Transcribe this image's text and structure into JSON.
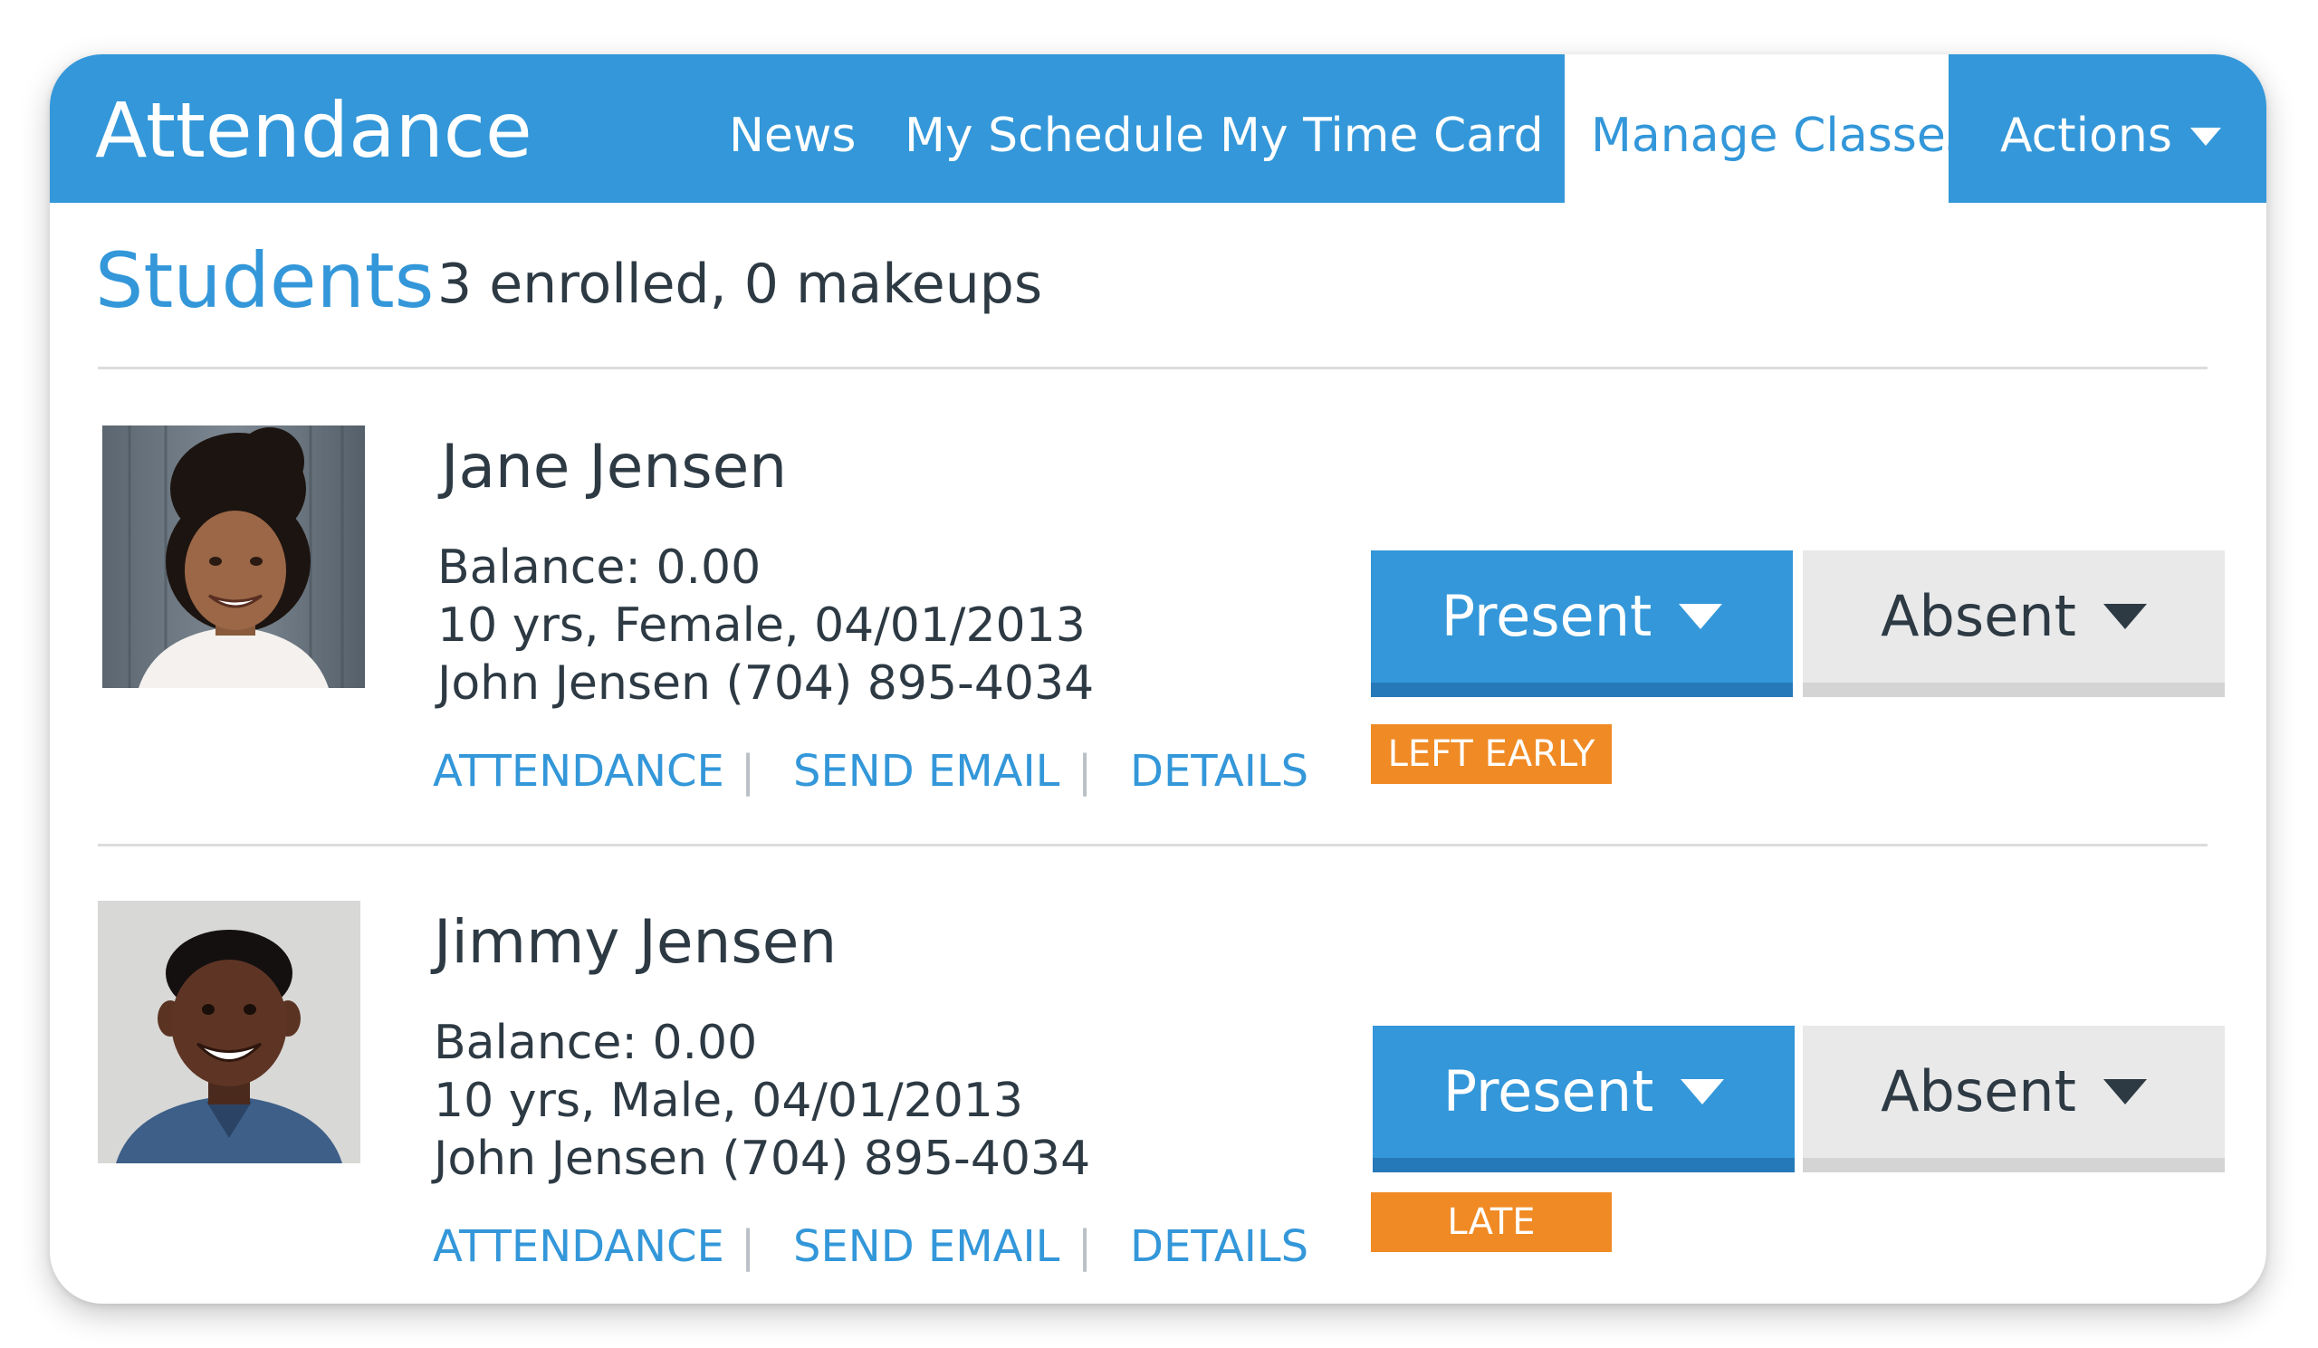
{
  "app": {
    "title": "Attendance"
  },
  "nav": {
    "news": "News",
    "schedule": "My Schedule",
    "timecard": "My Time Card",
    "manage_classes": "Manage Classes",
    "actions": "Actions",
    "active": "Manage Classes"
  },
  "section": {
    "title": "Students",
    "summary": "3 enrolled, 0 makeups"
  },
  "students": [
    {
      "name": "Jane Jensen",
      "balance": "Balance: 0.00",
      "demographics": "10 yrs, Female, 04/01/2013",
      "contact": "John Jensen (704) 895-4034",
      "links": {
        "attendance": "ATTENDANCE",
        "send_email": "SEND EMAIL",
        "details": "DETAILS",
        "separator": "|"
      },
      "present_label": "Present",
      "absent_label": "Absent",
      "status": "LEFT EARLY"
    },
    {
      "name": "Jimmy Jensen",
      "balance": "Balance: 0.00",
      "demographics": "10 yrs, Male, 04/01/2013",
      "contact": "John Jensen (704) 895-4034",
      "links": {
        "attendance": "ATTENDANCE",
        "send_email": "SEND EMAIL",
        "details": "DETAILS",
        "separator": "|"
      },
      "present_label": "Present",
      "absent_label": "Absent",
      "status": "LATE"
    }
  ],
  "colors": {
    "primary": "#3397d9",
    "primary_dark": "#2679b8",
    "badge": "#f08a24",
    "absent_bg": "#e9e9e9",
    "text": "#2d3a44"
  }
}
